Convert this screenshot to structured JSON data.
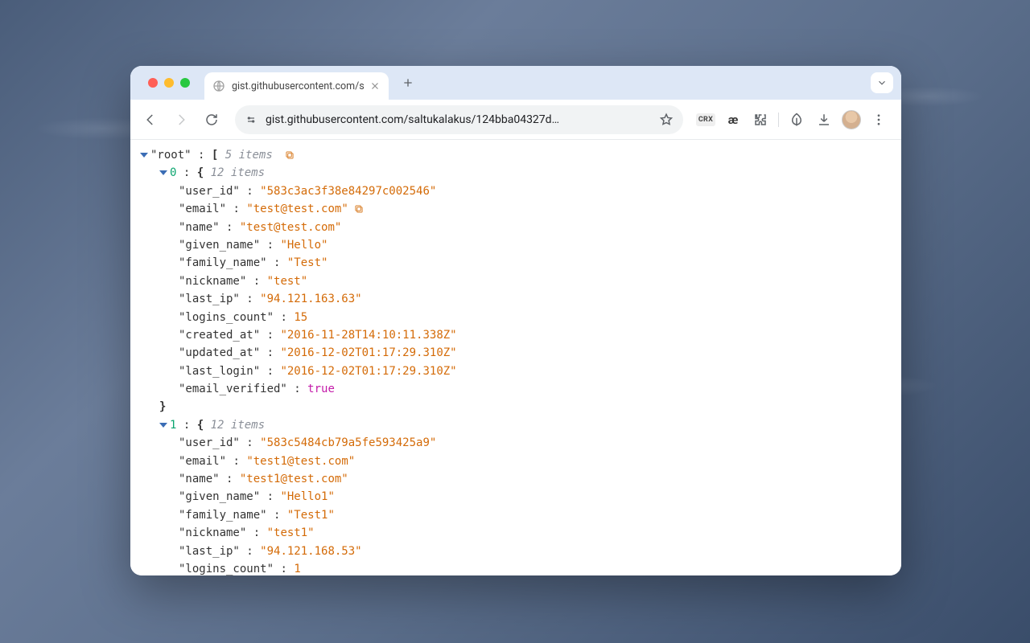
{
  "browser": {
    "tab_title": "gist.githubusercontent.com/s",
    "url_display": "gist.githubusercontent.com/saltukalakus/124bba04327d…",
    "crx_label": "CRX",
    "ae_label": "æ"
  },
  "json": {
    "root_label": "root",
    "root_count": "5 items",
    "items": [
      {
        "index": "0",
        "count": "12 items",
        "fields": [
          {
            "key": "user_id",
            "type": "string",
            "value": "583c3ac3f38e84297c002546",
            "copy": false
          },
          {
            "key": "email",
            "type": "string",
            "value": "test@test.com",
            "copy": true
          },
          {
            "key": "name",
            "type": "string",
            "value": "test@test.com",
            "copy": false
          },
          {
            "key": "given_name",
            "type": "string",
            "value": "Hello",
            "copy": false
          },
          {
            "key": "family_name",
            "type": "string",
            "value": "Test",
            "copy": false
          },
          {
            "key": "nickname",
            "type": "string",
            "value": "test",
            "copy": false
          },
          {
            "key": "last_ip",
            "type": "string",
            "value": "94.121.163.63",
            "copy": false
          },
          {
            "key": "logins_count",
            "type": "number",
            "value": "15",
            "copy": false
          },
          {
            "key": "created_at",
            "type": "string",
            "value": "2016-11-28T14:10:11.338Z",
            "copy": false
          },
          {
            "key": "updated_at",
            "type": "string",
            "value": "2016-12-02T01:17:29.310Z",
            "copy": false
          },
          {
            "key": "last_login",
            "type": "string",
            "value": "2016-12-02T01:17:29.310Z",
            "copy": false
          },
          {
            "key": "email_verified",
            "type": "boolean",
            "value": "true",
            "copy": false
          }
        ],
        "closed": true
      },
      {
        "index": "1",
        "count": "12 items",
        "fields": [
          {
            "key": "user_id",
            "type": "string",
            "value": "583c5484cb79a5fe593425a9",
            "copy": false
          },
          {
            "key": "email",
            "type": "string",
            "value": "test1@test.com",
            "copy": false
          },
          {
            "key": "name",
            "type": "string",
            "value": "test1@test.com",
            "copy": false
          },
          {
            "key": "given_name",
            "type": "string",
            "value": "Hello1",
            "copy": false
          },
          {
            "key": "family_name",
            "type": "string",
            "value": "Test1",
            "copy": false
          },
          {
            "key": "nickname",
            "type": "string",
            "value": "test1",
            "copy": false
          },
          {
            "key": "last_ip",
            "type": "string",
            "value": "94.121.168.53",
            "copy": false
          },
          {
            "key": "logins_count",
            "type": "number",
            "value": "1",
            "copy": false
          }
        ],
        "closed": false
      }
    ]
  }
}
